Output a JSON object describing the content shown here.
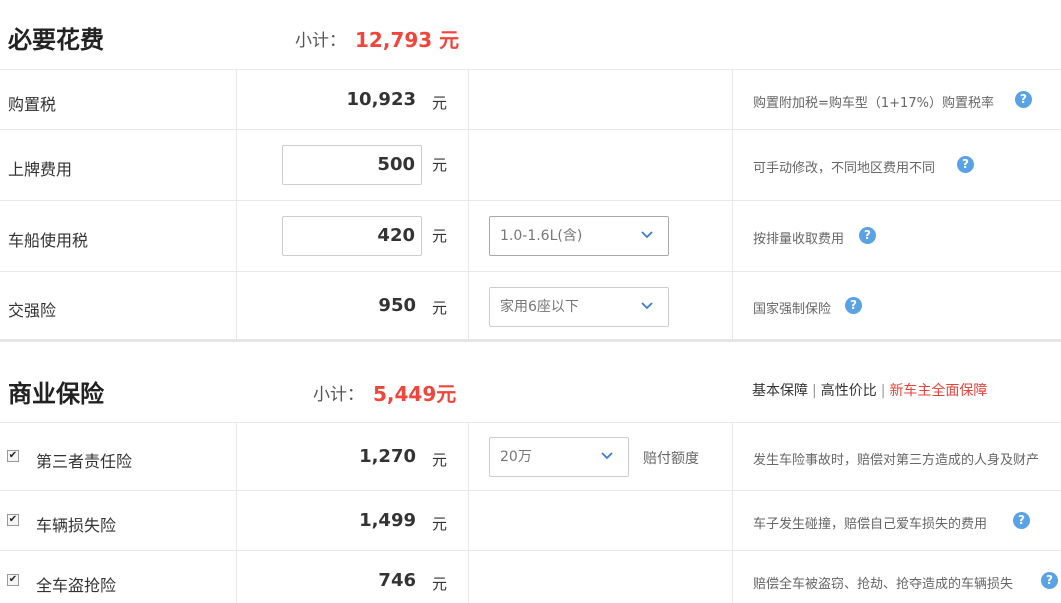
{
  "required": {
    "title": "必要花费",
    "subtotal_label": "小计：",
    "subtotal_value": "12,793 元",
    "rows": [
      {
        "label": "购置税",
        "amount": "10,923",
        "unit": "元",
        "desc": "购置附加税=购车型（1+17%）购置税率"
      },
      {
        "label": "上牌费用",
        "amount": "500",
        "unit": "元",
        "desc": "可手动修改，不同地区费用不同"
      },
      {
        "label": "车船使用税",
        "amount": "420",
        "unit": "元",
        "select": "1.0-1.6L(含)",
        "desc": "按排量收取费用"
      },
      {
        "label": "交强险",
        "amount": "950",
        "unit": "元",
        "select": "家用6座以下",
        "desc": "国家强制保险"
      }
    ]
  },
  "commercial": {
    "title": "商业保险",
    "subtotal_label": "小计：",
    "subtotal_value": "5,449元",
    "plans": [
      "基本保障",
      "高性价比",
      "新车主全面保障"
    ],
    "rows": [
      {
        "label": "第三者责任险",
        "checked": true,
        "amount": "1,270",
        "unit": "元",
        "select": "20万",
        "select_suffix": "赔付额度",
        "desc": "发生车险事故时，赔偿对第三方造成的人身及财产"
      },
      {
        "label": "车辆损失险",
        "checked": true,
        "amount": "1,499",
        "unit": "元",
        "desc": "车子发生碰撞，赔偿自己爱车损失的费用"
      },
      {
        "label": "全车盗抢险",
        "checked": true,
        "amount": "746",
        "unit": "元",
        "desc": "赔偿全车被盗窃、抢劫、抢夺造成的车辆损失"
      }
    ]
  },
  "icons": {
    "help": "?",
    "chevron": "chevron-down-icon",
    "check": "✔"
  },
  "colors": {
    "accent_red": "#f0453a",
    "help_blue": "#5aa2e6"
  }
}
